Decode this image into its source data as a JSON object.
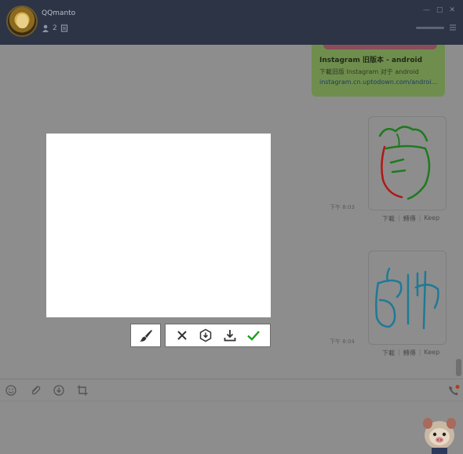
{
  "header": {
    "title": "QQmanto",
    "member_count": "2",
    "controls": [
      "—",
      "□",
      "✕"
    ]
  },
  "link_card": {
    "title": "Instagram 旧版本 - android",
    "subtitle": "下載旧版 Instagram 对于 android",
    "url": "instagram.cn.uptodown.com/androi..."
  },
  "messages": [
    {
      "time": "下午 8:03",
      "actions": [
        "下載",
        "轉傳",
        "Keep"
      ]
    },
    {
      "time": "下午 8:04",
      "actions": [
        "下載",
        "轉傳",
        "Keep"
      ]
    }
  ],
  "toolbar": {
    "icons": [
      "smiley-icon",
      "paperclip-icon",
      "download-circle-icon",
      "crop-icon"
    ]
  },
  "canvas_tools": {
    "brush": "brush-icon",
    "group": [
      "close-icon",
      "hexagon-down-icon",
      "download-tray-icon",
      "check-icon"
    ]
  },
  "colors": {
    "header_bg": "#2c3445",
    "overlay": "#8d8d8d",
    "link_card_bg": "#6f8e4e",
    "drawing_red": "#b01818",
    "drawing_green": "#1e7a1e",
    "drawing_teal": "#1f7a96",
    "check_green": "#19a019"
  }
}
